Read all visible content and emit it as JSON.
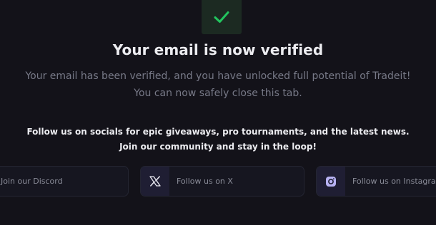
{
  "verify": {
    "status_icon": "checkmark-icon",
    "title": "Your email is now verified",
    "message_line1": "Your email has been verified, and you have unlocked full potential of Tradeit!",
    "message_line2": "You can now safely close this tab."
  },
  "community": {
    "headline_line1": "Follow us on socials for epic giveaways, pro tournaments, and the latest news.",
    "headline_line2": "Join our community and stay in the loop!"
  },
  "socials": [
    {
      "label": "Join our Discord",
      "icon": "discord-icon"
    },
    {
      "label": "Follow us on X",
      "icon": "x-logo-icon"
    },
    {
      "label": "Follow us on Instagram",
      "icon": "instagram-icon"
    }
  ],
  "colors": {
    "background": "#131219",
    "success_green": "#22c55e",
    "card_border": "#242532",
    "icon_tile": "#1f1e33"
  }
}
